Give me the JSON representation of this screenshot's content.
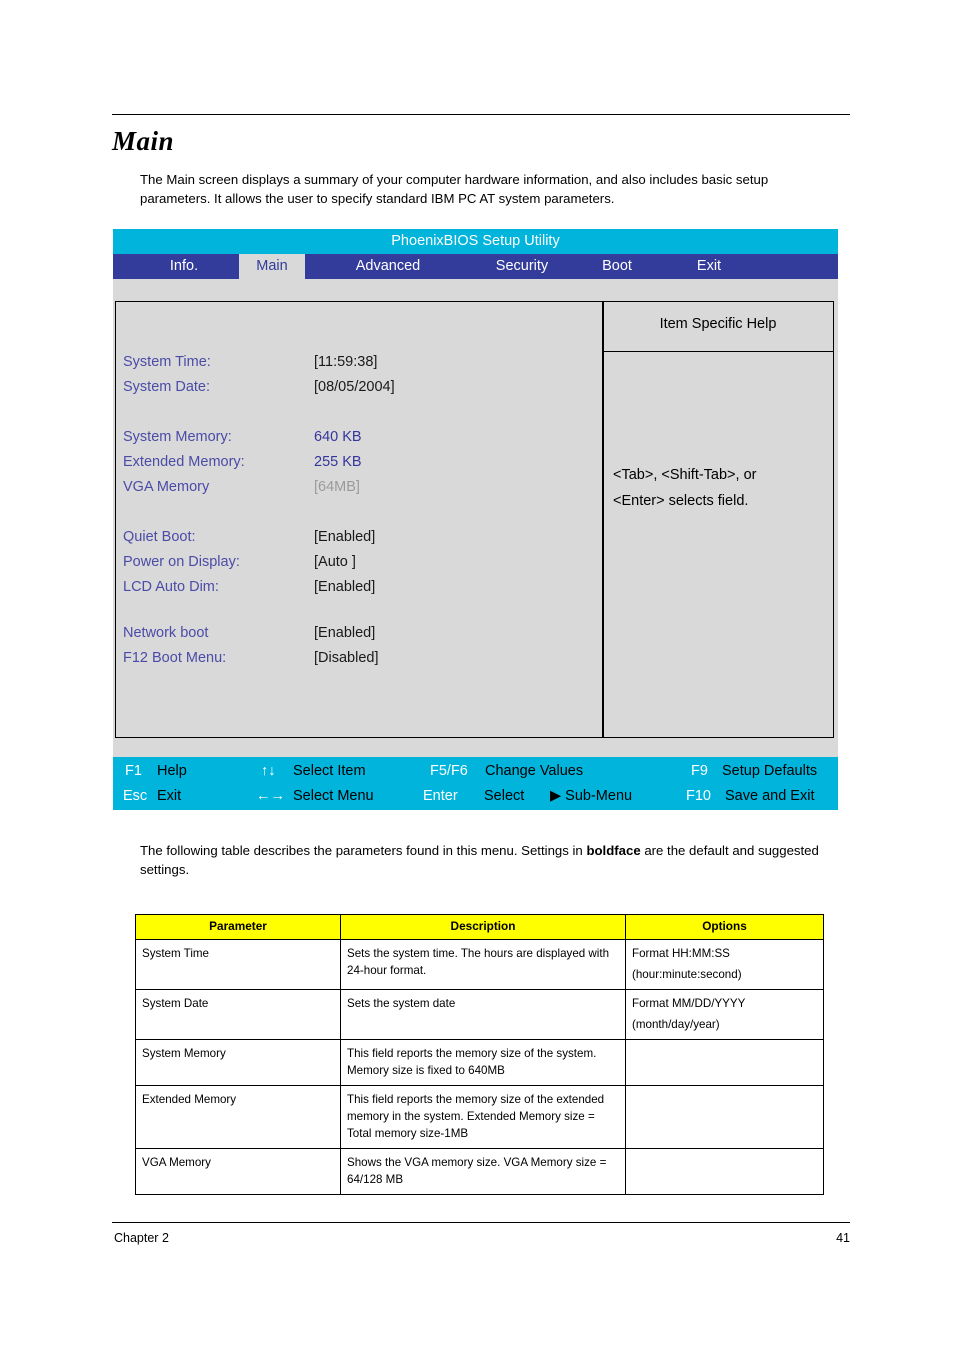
{
  "document": {
    "section_title": "Main",
    "intro_paragraph": "The Main screen displays a summary of your computer hardware information, and also includes basic setup parameters. It allows the user to specify standard IBM PC AT system parameters.",
    "mid_paragraph_before": "The following table describes the parameters found in this menu. Settings in ",
    "mid_paragraph_bold": "boldface",
    "mid_paragraph_after": " are the default and suggested settings.",
    "footer_left": "Chapter 2",
    "footer_right": "41"
  },
  "bios": {
    "title": "PhoenixBIOS Setup Utility",
    "colors": {
      "titlebar": "#00b4dc",
      "tabbar": "#333b9b",
      "active_tab_bg": "#d9d9d9",
      "panel_bg": "#d9d9d9",
      "label": "#4b4ba8",
      "fnbar": "#00b4dc"
    },
    "tabs": [
      {
        "label": "Info.",
        "active": false
      },
      {
        "label": "Main",
        "active": true
      },
      {
        "label": "Advanced",
        "active": false
      },
      {
        "label": "Security",
        "active": false
      },
      {
        "label": "Boot",
        "active": false
      },
      {
        "label": "Exit",
        "active": false
      }
    ],
    "settings": [
      {
        "label": "System Time:",
        "value": "[11:59:38]",
        "style": "dark"
      },
      {
        "label": "System Date:",
        "value": "[08/05/2004]",
        "style": "dark"
      },
      {
        "label": "System Memory:",
        "value": "640 KB",
        "style": "blue"
      },
      {
        "label": "Extended Memory:",
        "value": "255 KB",
        "style": "blue"
      },
      {
        "label": "VGA Memory",
        "value": "[64MB]",
        "style": "muted"
      },
      {
        "label": "Quiet Boot:",
        "value": "[Enabled]",
        "style": "dark"
      },
      {
        "label": "Power on Display:",
        "value": "[Auto ]",
        "style": "dark"
      },
      {
        "label": "LCD Auto Dim:",
        "value": "[Enabled]",
        "style": "dark"
      },
      {
        "label": "Network boot",
        "value": "[Enabled]",
        "style": "dark"
      },
      {
        "label": "F12 Boot Menu:",
        "value": "[Disabled]",
        "style": "dark"
      }
    ],
    "help": {
      "title": "Item Specific Help",
      "line1": "<Tab>, <Shift-Tab>, or",
      "line2": "<Enter> selects field."
    },
    "function_keys": {
      "row1": [
        {
          "key": "F1",
          "action": "Help"
        },
        {
          "key": "↑↓",
          "action": "Select Item"
        },
        {
          "key": "F5/F6",
          "action": "Change Values"
        },
        {
          "key": "F9",
          "action": "Setup Defaults"
        }
      ],
      "row2": [
        {
          "key": "Esc",
          "action": "Exit"
        },
        {
          "key": "←→",
          "action": "Select Menu"
        },
        {
          "key": "Enter",
          "action": "Select"
        },
        {
          "key": "",
          "action": "▶ Sub-Menu"
        },
        {
          "key": "F10",
          "action": "Save and Exit"
        }
      ]
    }
  },
  "parameter_table": {
    "headers": [
      "Parameter",
      "Description",
      "Options"
    ],
    "rows": [
      {
        "parameter": "System Time",
        "description": [
          "Sets the system time. The hours are displayed with 24-hour format."
        ],
        "options": [
          "Format  HH:MM:SS",
          "(hour:minute:second)"
        ]
      },
      {
        "parameter": "System Date",
        "description": [
          "Sets the system date"
        ],
        "options": [
          "Format  MM/DD/YYYY",
          "(month/day/year)"
        ]
      },
      {
        "parameter": "System Memory",
        "description": [
          "This field reports the memory size of the system. Memory size is fixed to 640MB"
        ],
        "options": []
      },
      {
        "parameter": "Extended Memory",
        "description": [
          "This field reports the memory size of the extended memory in the system. Extended Memory size = Total memory size-1MB"
        ],
        "options": []
      },
      {
        "parameter": "VGA Memory",
        "description": [
          "Shows the VGA memory size. VGA Memory size = 64/128 MB"
        ],
        "options": []
      }
    ]
  }
}
